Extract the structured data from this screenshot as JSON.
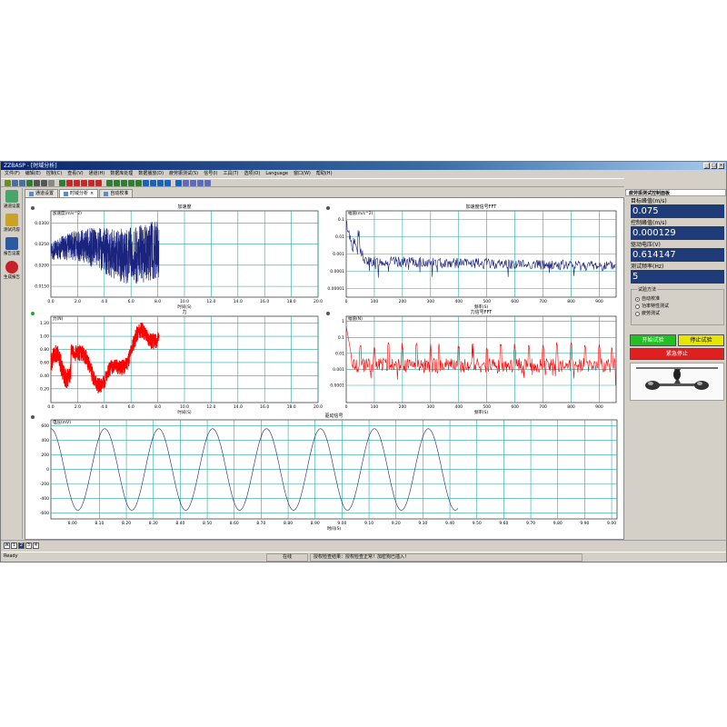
{
  "window": {
    "title": "ZZBASP - [时域分析]",
    "menu": [
      "文件(F)",
      "编辑(E)",
      "控制(C)",
      "查看(V)",
      "通道(H)",
      "数据库处理",
      "数据播放(D)",
      "疲劳振测试(S)",
      "信号(I)",
      "工具(T)",
      "选项(O)",
      "Language",
      "窗口(W)",
      "帮助(H)"
    ]
  },
  "left_toolbar": {
    "items": [
      {
        "label": "通道设置",
        "icon": "channel-settings-icon",
        "color": "#4aa36b"
      },
      {
        "label": "测试内容",
        "icon": "test-content-icon",
        "color": "#c9a227"
      },
      {
        "label": "报告设置",
        "icon": "word-report-icon",
        "color": "#2c5aa0"
      },
      {
        "label": "生成报告",
        "icon": "generate-report-icon",
        "color": "#c8202a"
      }
    ]
  },
  "tabs": [
    {
      "label": "通道设置",
      "active": false
    },
    {
      "label": "时域分析",
      "active": true,
      "closable": "×"
    },
    {
      "label": "自动校准",
      "active": false
    }
  ],
  "charts": {
    "accel": {
      "title": "加速度",
      "ylabel": "加速度(m/s^2)",
      "xlabel": "时间(S)",
      "yticks": [
        "0.0300",
        "0.0250",
        "0.0200",
        "0.0150"
      ],
      "xticks": [
        "0.0",
        "2.0",
        "4.0",
        "6.0",
        "8.0",
        "10.0",
        "12.0",
        "14.0",
        "16.0",
        "18.0",
        "20.0"
      ]
    },
    "accel_fft": {
      "title": "加速度信号FFT",
      "ylabel": "幅值(m/s^2)",
      "xlabel": "频率(S)",
      "yticks": [
        "0.1",
        "0.01",
        "0.001",
        "0.0001",
        "0.00001"
      ],
      "xticks": [
        "0",
        "100",
        "200",
        "300",
        "400",
        "500",
        "600",
        "700",
        "800",
        "900"
      ]
    },
    "force": {
      "title": "力",
      "ylabel": "力(N)",
      "xlabel": "时间(S)",
      "yticks": [
        "1.20",
        "1.00",
        "0.80",
        "0.60",
        "0.40",
        "0.20"
      ],
      "xticks": [
        "0.0",
        "2.0",
        "4.0",
        "6.0",
        "8.0",
        "10.0",
        "12.0",
        "14.0",
        "16.0",
        "18.0",
        "20.0"
      ]
    },
    "force_fft": {
      "title": "力信号FFT",
      "ylabel": "幅值(N)",
      "xlabel": "频率(S)",
      "yticks": [
        "1",
        "0.1",
        "0.01",
        "0.001",
        "0.0001"
      ],
      "xticks": [
        "0",
        "100",
        "200",
        "300",
        "400",
        "500",
        "600",
        "700",
        "800",
        "900"
      ]
    },
    "drive": {
      "title": "驱动信号",
      "ylabel": "电压(mV)",
      "xlabel": "时间(S)",
      "yticks": [
        "600",
        "400",
        "200",
        "0",
        "-200",
        "-400",
        "-600"
      ],
      "xticks": [
        "8.00",
        "8.10",
        "8.20",
        "8.30",
        "8.40",
        "8.50",
        "8.60",
        "8.70",
        "8.80",
        "8.90",
        "9.00",
        "9.10",
        "9.20",
        "9.30",
        "9.40",
        "9.50",
        "9.60",
        "9.70",
        "9.80",
        "9.90",
        "9.00"
      ]
    }
  },
  "chart_data": [
    {
      "type": "line",
      "title": "加速度",
      "xlabel": "时间(S)",
      "ylabel": "加速度(m/s^2)",
      "xlim": [
        0,
        20
      ],
      "ylim": [
        0.0135,
        0.0325
      ],
      "color": "#1a237e",
      "data_end_x": 8.1
    },
    {
      "type": "line",
      "title": "加速度信号FFT",
      "xlabel": "频率(S)",
      "ylabel": "幅值(m/s^2)",
      "xlim": [
        0,
        960
      ],
      "ylim": [
        3e-06,
        0.2
      ],
      "scale": "log",
      "color": "#1a237e"
    },
    {
      "type": "line",
      "title": "力",
      "xlabel": "时间(S)",
      "ylabel": "力(N)",
      "xlim": [
        0,
        20
      ],
      "ylim": [
        0.05,
        1.3
      ],
      "color": "#ff0000",
      "data_end_x": 8.1
    },
    {
      "type": "line",
      "title": "力信号FFT",
      "xlabel": "频率(S)",
      "ylabel": "幅值(N)",
      "xlim": [
        0,
        960
      ],
      "ylim": [
        3e-05,
        2
      ],
      "scale": "log",
      "color": "#ff0000"
    },
    {
      "type": "line",
      "title": "驱动信号",
      "xlabel": "时间(S)",
      "ylabel": "电压(mV)",
      "xlim": [
        7.92,
        10.02
      ],
      "ylim": [
        -680,
        680
      ],
      "color": "#1a237e",
      "amplitude": 560,
      "frequency_hz": 5,
      "data_end_x": 9.43
    }
  ],
  "side_panel": {
    "title": "疲劳振测试控制面板",
    "params": [
      {
        "label": "目标峰值(m/s)",
        "value": "0.075"
      },
      {
        "label": "控制峰值(m/s)",
        "value": "0.000129"
      },
      {
        "label": "驱动电压(V)",
        "value": "0.614147"
      },
      {
        "label": "测试频率(Hz)",
        "value": "5"
      }
    ],
    "method_title": "试验方法",
    "methods": [
      {
        "label": "自动校准",
        "selected": true
      },
      {
        "label": "功率特性测试",
        "selected": false
      },
      {
        "label": "疲劳测试",
        "selected": false
      }
    ],
    "start_label": "开始试验",
    "stop_label": "停止试验",
    "estop_label": "紧急停止",
    "start_color": "#22c022",
    "stop_color": "#e6e600",
    "estop_color": "#e02020"
  },
  "page_tabs": [
    "A",
    "1",
    "2",
    "3",
    "4"
  ],
  "status": {
    "ready": "Ready",
    "online": "在线",
    "message": "授权检查结果：授权检查正常！加密狗已插入！"
  }
}
